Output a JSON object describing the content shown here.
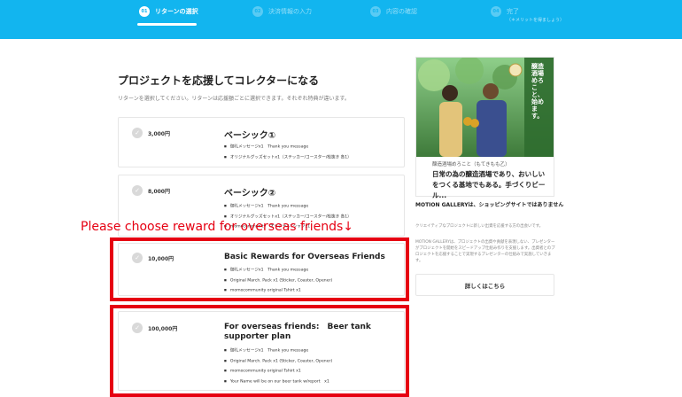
{
  "steps": [
    {
      "num": "01",
      "label": "リターンの選択",
      "sub": ""
    },
    {
      "num": "02",
      "label": "決済情報の入力",
      "sub": ""
    },
    {
      "num": "03",
      "label": "内容の確認",
      "sub": ""
    },
    {
      "num": "04",
      "label": "完了",
      "sub": "（＊メリットを得ましょう）"
    }
  ],
  "main": {
    "title": "プロジェクトを応援してコレクターになる",
    "description": "リターンを選択してください。リターンは応援額ごとに選択できます。それぞれ特典が違います。",
    "overseas_note": "Please choose reward for overseas friends↓"
  },
  "rewards": [
    {
      "price": "3,000円",
      "name": "ベーシック①",
      "items": [
        "御礼メッセージx1　Thank you message",
        "オリジナルグッズセットx1（ステッカー/コースター/栓抜き 各1）"
      ]
    },
    {
      "price": "8,000円",
      "name": "ベーシック②",
      "items": [
        "御礼メッセージx1　Thank you message",
        "オリジナルグッズセットx1（ステッカー/コースター/栓抜き 各1）",
        "momocommunity　オリジナルTシャツx1"
      ]
    },
    {
      "price": "10,000円",
      "name": "Basic Rewards for Overseas Friends",
      "items": [
        "御礼メッセージx1　Thank you message",
        "Original March. Pack x1 (Sticker, Coaster, Opener)",
        "momocommunity original Tshirt x1"
      ]
    },
    {
      "price": "100,000円",
      "name": "For overseas friends:　Beer tank supporter plan",
      "items": [
        "御礼メッセージx1　Thank you message",
        "Original March. Pack x1 (Sticker, Coaster, Opener)",
        "momocommunity original Tshirt x1",
        "Your Name will be on our beer tank w/report　x1"
      ]
    }
  ],
  "project": {
    "subtitle": "醸造酒場めろこと（もてきもも乙）",
    "title": "日常の為の醸造酒場であり、おいしいをつくる基地でもある。手づくりビール...",
    "photo_text": "醸造酒場 めろこと、始めます。"
  },
  "motion_gallery": {
    "heading": "MOTION GALLERYは、ショッピングサイトではありません",
    "desc1": "クリエイティブなプロジェクトに新しい出資を応援する方の出会いです。",
    "desc2": "MOTION GALLERYは、プロジェクトの出資や貢献を表現しない、プレゼンターがプロジェクトを開始をスピードアップ仕組み作りを支援します。出資者とのプロジェクトを応援することで実現するプレゼンターの仕組みで実施していきます。",
    "button_label": "詳しくはこちら"
  },
  "colors": {
    "header": "#12b5ef",
    "highlight": "#e60012"
  }
}
